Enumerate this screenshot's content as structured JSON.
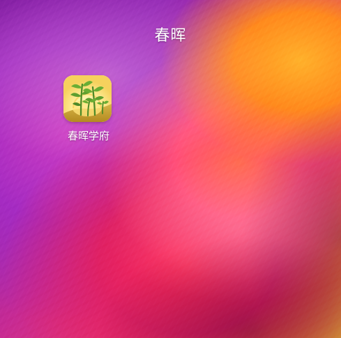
{
  "home_screen": {
    "title": "春晖",
    "apps": [
      {
        "label": "春晖学府",
        "icon": "seedlings-sunrise-icon"
      }
    ],
    "wallpaper": {
      "icon": "abstract-wave-wallpaper",
      "colors": [
        "#6f1a8f",
        "#c52a95",
        "#f0356e",
        "#ff8f24",
        "#ffc33a"
      ]
    }
  }
}
